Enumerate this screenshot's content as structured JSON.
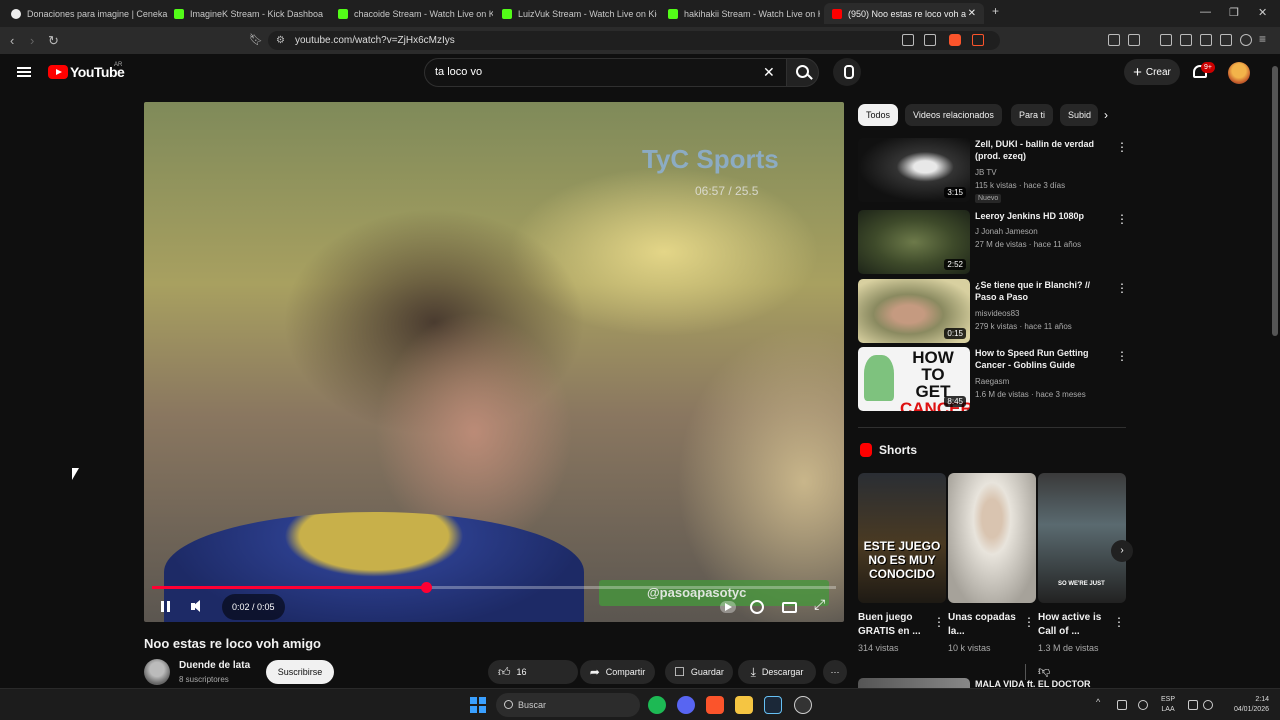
{
  "browser": {
    "tabs": [
      {
        "label": "Donaciones para imagine | Ceneka",
        "color": "#dddddd"
      },
      {
        "label": "ImagineK Stream - Kick Dashboa",
        "color": "#53fc18"
      },
      {
        "label": "chacoide Stream - Watch Live on Kick",
        "color": "#53fc18"
      },
      {
        "label": "LuizVuk Stream - Watch Live on Kick",
        "color": "#53fc18"
      },
      {
        "label": "hakihakii Stream - Watch Live on Kick",
        "color": "#53fc18"
      },
      {
        "label": "(950) Noo estas re loco voh a",
        "color": "#ff0000"
      }
    ],
    "url": "youtube.com/watch?v=ZjHx6cMzIys"
  },
  "youtube": {
    "logo_text": "YouTube",
    "country_code": "AR",
    "search_value": "ta loco vo",
    "create_label": "Crear",
    "notifications_badge": "9+"
  },
  "video": {
    "title": "Noo estas re loco voh amigo",
    "time_display": "0:02 / 0:05",
    "progress_fraction": 0.4,
    "overlay_logo": "TyC Sports",
    "overlay_clock": "06:57 / 25.5",
    "overlay_handle": "@pasoapasotyc"
  },
  "channel": {
    "name": "Duende de lata",
    "subscribers": "8 suscriptores",
    "subscribe_label": "Suscribirse"
  },
  "actions": {
    "like_count": "16",
    "share_label": "Compartir",
    "save_label": "Guardar",
    "download_label": "Descargar"
  },
  "chips": [
    "Todos",
    "Videos relacionados",
    "Para ti",
    "Subid"
  ],
  "recommendations": [
    {
      "title": "Zell, DUKI - ballin de verdad (prod. ezeq)",
      "channel": "JB TV",
      "meta": "115 k vistas · hace 3 días",
      "badge": "Nuevo",
      "duration": "3:15"
    },
    {
      "title": "Leeroy Jenkins HD 1080p",
      "channel": "J Jonah Jameson",
      "meta": "27 M de vistas · hace 11 años",
      "badge": "",
      "duration": "2:52"
    },
    {
      "title": "¿Se tiene que ir Blanchi? // Paso a Paso",
      "channel": "misvideos83",
      "meta": "279 k vistas · hace 11 años",
      "badge": "",
      "duration": "0:15"
    },
    {
      "title": "How to Speed Run Getting Cancer - Goblins Guide",
      "channel": "Raegasm",
      "meta": "1.6 M de vistas · hace 3 meses",
      "badge": "",
      "duration": "8:45",
      "thumb_text_1": "HOW TO",
      "thumb_text_2": "GET",
      "thumb_text_3": "CANCER"
    }
  ],
  "shorts": {
    "heading": "Shorts",
    "items": [
      {
        "title": "Buen juego GRATIS en ...",
        "views": "314 vistas",
        "overlay": "ESTE JUEGO NO ES MUY CONOCIDO"
      },
      {
        "title": "Unas copadas la...",
        "views": "10 k vistas",
        "overlay": ""
      },
      {
        "title": "How active is Call of ...",
        "views": "1.3 M de vistas",
        "overlay": "SO WE'RE JUST"
      }
    ]
  },
  "next_rec_title": "MALA VIDA ft. EL DOCTOR",
  "taskbar": {
    "search_placeholder": "Buscar",
    "lang_1": "ESP",
    "lang_2": "LAA",
    "time": "2:14",
    "date": "04/01/2026"
  }
}
